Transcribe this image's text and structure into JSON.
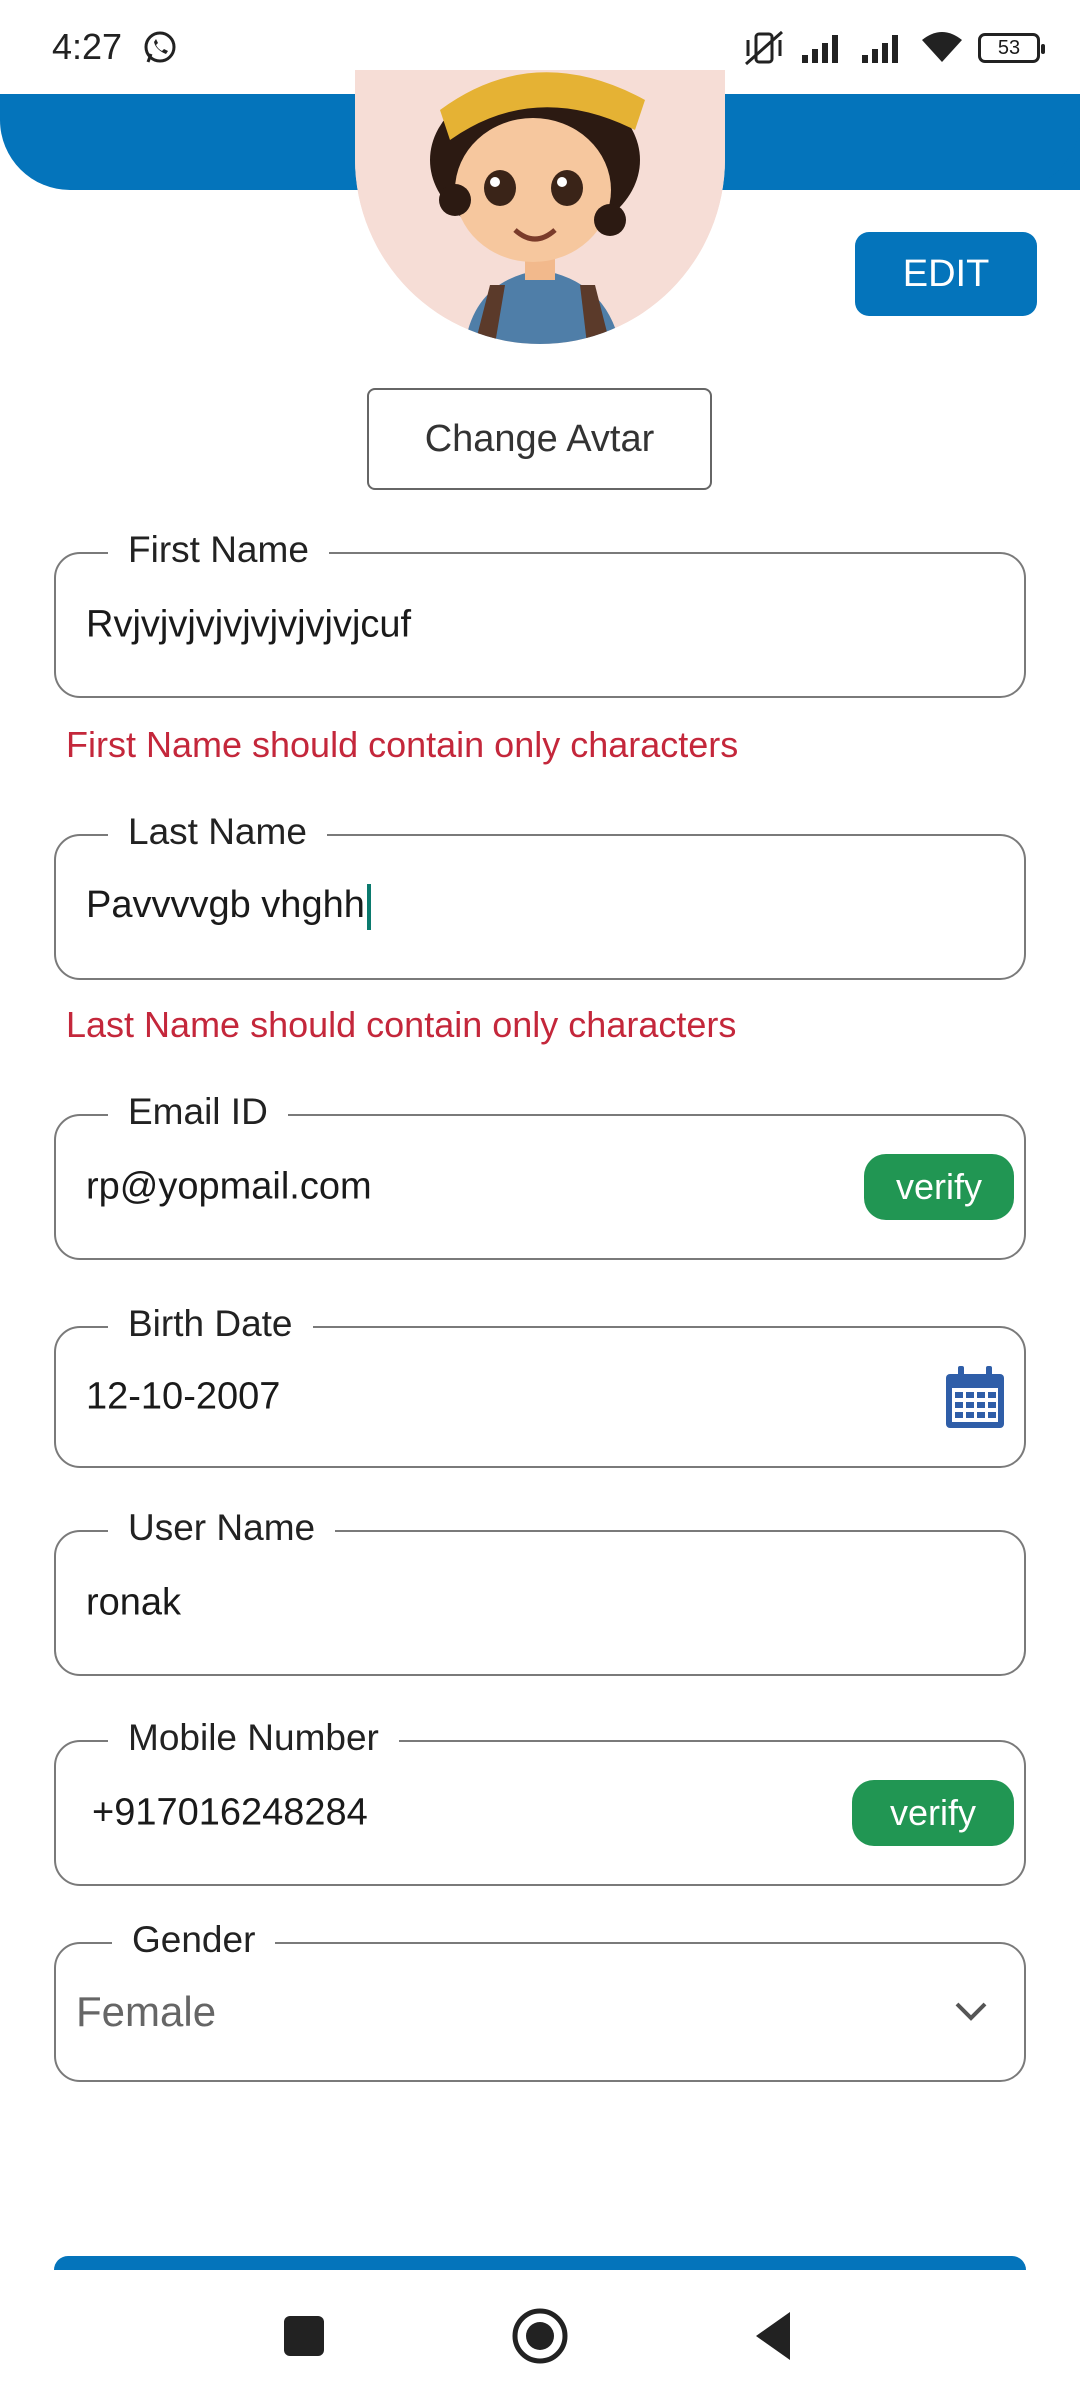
{
  "status_bar": {
    "time": "4:27",
    "battery": "53"
  },
  "profile": {
    "edit_label": "EDIT",
    "change_avatar_label": "Change Avtar"
  },
  "fields": {
    "first_name": {
      "label": "First Name",
      "value": "Rvjvjvjvjvjvjvjvjvjcuf",
      "error": "First Name should contain only characters"
    },
    "last_name": {
      "label": "Last Name",
      "value": "Pavvvvgb vhghh",
      "error": "Last Name should contain only characters"
    },
    "email": {
      "label": "Email ID",
      "value": "rp@yopmail.com",
      "verify_label": "verify"
    },
    "birth_date": {
      "label": "Birth Date",
      "value": "12-10-2007"
    },
    "user_name": {
      "label": "User Name",
      "value": "ronak"
    },
    "mobile": {
      "label": "Mobile Number",
      "value": "+917016248284",
      "verify_label": "verify"
    },
    "gender": {
      "label": "Gender",
      "value": "Female"
    }
  },
  "colors": {
    "primary": "#0474bb",
    "verify_green": "#219653",
    "error_red": "#c4273b"
  }
}
